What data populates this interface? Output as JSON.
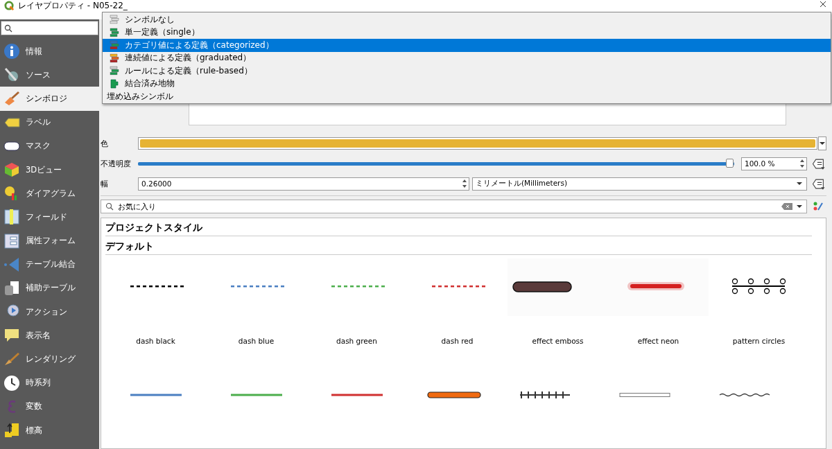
{
  "window": {
    "title": "レイヤプロパティ - N05-22_"
  },
  "sidebar": {
    "items": [
      {
        "label": "情報",
        "selected": false
      },
      {
        "label": "ソース",
        "selected": false
      },
      {
        "label": "シンボロジ",
        "selected": true
      },
      {
        "label": "ラベル",
        "selected": false
      },
      {
        "label": "マスク",
        "selected": false
      },
      {
        "label": "3Dビュー",
        "selected": false
      },
      {
        "label": "ダイアグラム",
        "selected": false
      },
      {
        "label": "フィールド",
        "selected": false
      },
      {
        "label": "属性フォーム",
        "selected": false
      },
      {
        "label": "テーブル結合",
        "selected": false
      },
      {
        "label": "補助テーブル",
        "selected": false
      },
      {
        "label": "アクション",
        "selected": false
      },
      {
        "label": "表示名",
        "selected": false
      },
      {
        "label": "レンダリング",
        "selected": false
      },
      {
        "label": "時系列",
        "selected": false
      },
      {
        "label": "変数",
        "selected": false
      },
      {
        "label": "標高",
        "selected": false
      }
    ]
  },
  "renderer_menu": {
    "items": [
      {
        "kind": "none",
        "label": "シンボルなし",
        "selected": false
      },
      {
        "kind": "single",
        "label": "単一定義（single）",
        "selected": false
      },
      {
        "kind": "categorized",
        "label": "カテゴリ値による定義（categorized）",
        "selected": true
      },
      {
        "kind": "graduated",
        "label": "連続値による定義（graduated）",
        "selected": false
      },
      {
        "kind": "rule",
        "label": "ルールによる定義（rule-based）",
        "selected": false
      },
      {
        "kind": "merged",
        "label": "結合済み地物",
        "selected": false
      },
      {
        "kind": "embedded",
        "label": "埋め込みシンボル",
        "selected": false
      }
    ]
  },
  "color_field": {
    "label": "色",
    "color": "#e6b333"
  },
  "opacity": {
    "label": "不透明度",
    "level": 1,
    "reading": "100.0 %"
  },
  "width": {
    "label": "幅",
    "value": "0.26000",
    "unit": "ミリメートル(Millimeters)"
  },
  "symbol_search": {
    "value": "お気に入り"
  },
  "library": {
    "groups": [
      "プロジェクトスタイル",
      "デフォルト"
    ],
    "symbols": [
      {
        "kind": "dash",
        "name": "dash  black",
        "color": "#000000"
      },
      {
        "kind": "dash",
        "name": "dash blue",
        "color": "#4a7fc1"
      },
      {
        "kind": "dash",
        "name": "dash green",
        "color": "#4cae4c"
      },
      {
        "kind": "dash",
        "name": "dash red",
        "color": "#d03030"
      },
      {
        "kind": "emboss",
        "name": "effect emboss",
        "color": "#5a3a3a"
      },
      {
        "kind": "neon",
        "name": "effect neon",
        "color": "#d42020"
      },
      {
        "kind": "circles",
        "name": "pattern circles",
        "color": "#000000"
      },
      {
        "kind": "solid",
        "color": "#4a7fc1"
      },
      {
        "kind": "solid",
        "color": "#4cae4c"
      },
      {
        "kind": "solid",
        "color": "#d03030"
      },
      {
        "kind": "outlined",
        "color": "#f06a10"
      },
      {
        "kind": "ticks",
        "color": "#333333"
      },
      {
        "kind": "hollow",
        "color": "#777777"
      },
      {
        "kind": "wavy",
        "color": "#333333"
      }
    ]
  }
}
